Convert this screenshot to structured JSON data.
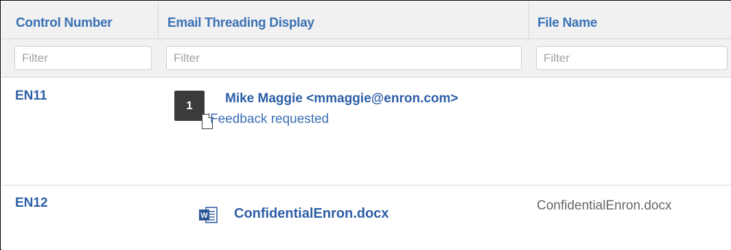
{
  "grid": {
    "columns": [
      {
        "id": "control_number",
        "label": "Control Number"
      },
      {
        "id": "email_threading_display",
        "label": "Email Threading Display"
      },
      {
        "id": "file_name",
        "label": "File Name"
      }
    ],
    "filters": {
      "control_number": {
        "placeholder": "Filter",
        "value": ""
      },
      "email_threading_display": {
        "placeholder": "Filter",
        "value": ""
      },
      "file_name": {
        "placeholder": "Filter",
        "value": ""
      }
    },
    "rows": [
      {
        "control_number": "EN11",
        "thread_badge": "1",
        "thread_icon": "email-thread-badge-icon",
        "attachment_icon": "document-icon",
        "sender": "Mike Maggie <mmaggie@enron.com>",
        "subject": "Feedback requested",
        "file_name": ""
      },
      {
        "control_number": "EN12",
        "doc_icon": "word-document-icon",
        "doc_name": "ConfidentialEnron.docx",
        "file_name": "ConfidentialEnron.docx"
      }
    ]
  },
  "colors": {
    "header_text": "#3a72b6",
    "link": "#2c5ea6",
    "header_bg": "#f1f1f1",
    "badge_bg": "#3b3b3b",
    "word_blue": "#2b5797"
  }
}
